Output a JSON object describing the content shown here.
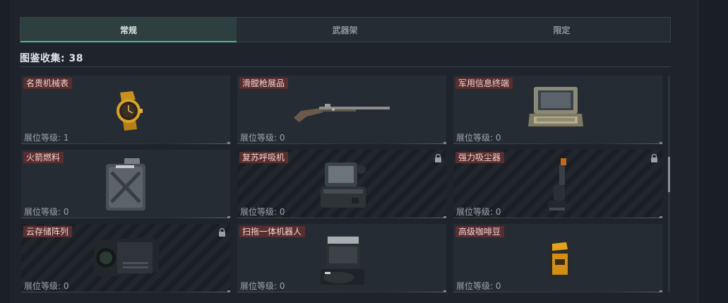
{
  "tabs": [
    {
      "label": "常规",
      "active": true
    },
    {
      "label": "武器架",
      "active": false
    },
    {
      "label": "限定",
      "active": false
    }
  ],
  "collection": {
    "text": "图鉴收集: 38"
  },
  "colors": {
    "active_tab_accent": "#4fb3a3",
    "name_tag_bg": "#5a2e2e"
  },
  "items": [
    {
      "name": "名贵机械表",
      "level": "展位等级: 1",
      "locked": false,
      "icon": "gold-watch-icon"
    },
    {
      "name": "滑膛枪展品",
      "level": "展位等级: 0",
      "locked": false,
      "icon": "musket-icon"
    },
    {
      "name": "军用信息终端",
      "level": "展位等级: 0",
      "locked": false,
      "icon": "military-terminal-icon"
    },
    {
      "name": "火箭燃料",
      "level": "展位等级: 0",
      "locked": false,
      "icon": "fuel-can-icon"
    },
    {
      "name": "复苏呼吸机",
      "level": "展位等级: 0",
      "locked": true,
      "icon": "ventilator-icon"
    },
    {
      "name": "强力吸尘器",
      "level": "展位等级: 0",
      "locked": true,
      "icon": "vacuum-cleaner-icon"
    },
    {
      "name": "云存储阵列",
      "level": "展位等级: 0",
      "locked": true,
      "icon": "storage-array-icon"
    },
    {
      "name": "扫拖一体机器人",
      "level": "展位等级: 0",
      "locked": false,
      "icon": "robot-vacuum-dock-icon"
    },
    {
      "name": "高级咖啡豆",
      "level": "展位等级: 0",
      "locked": false,
      "icon": "coffee-bag-icon"
    }
  ]
}
